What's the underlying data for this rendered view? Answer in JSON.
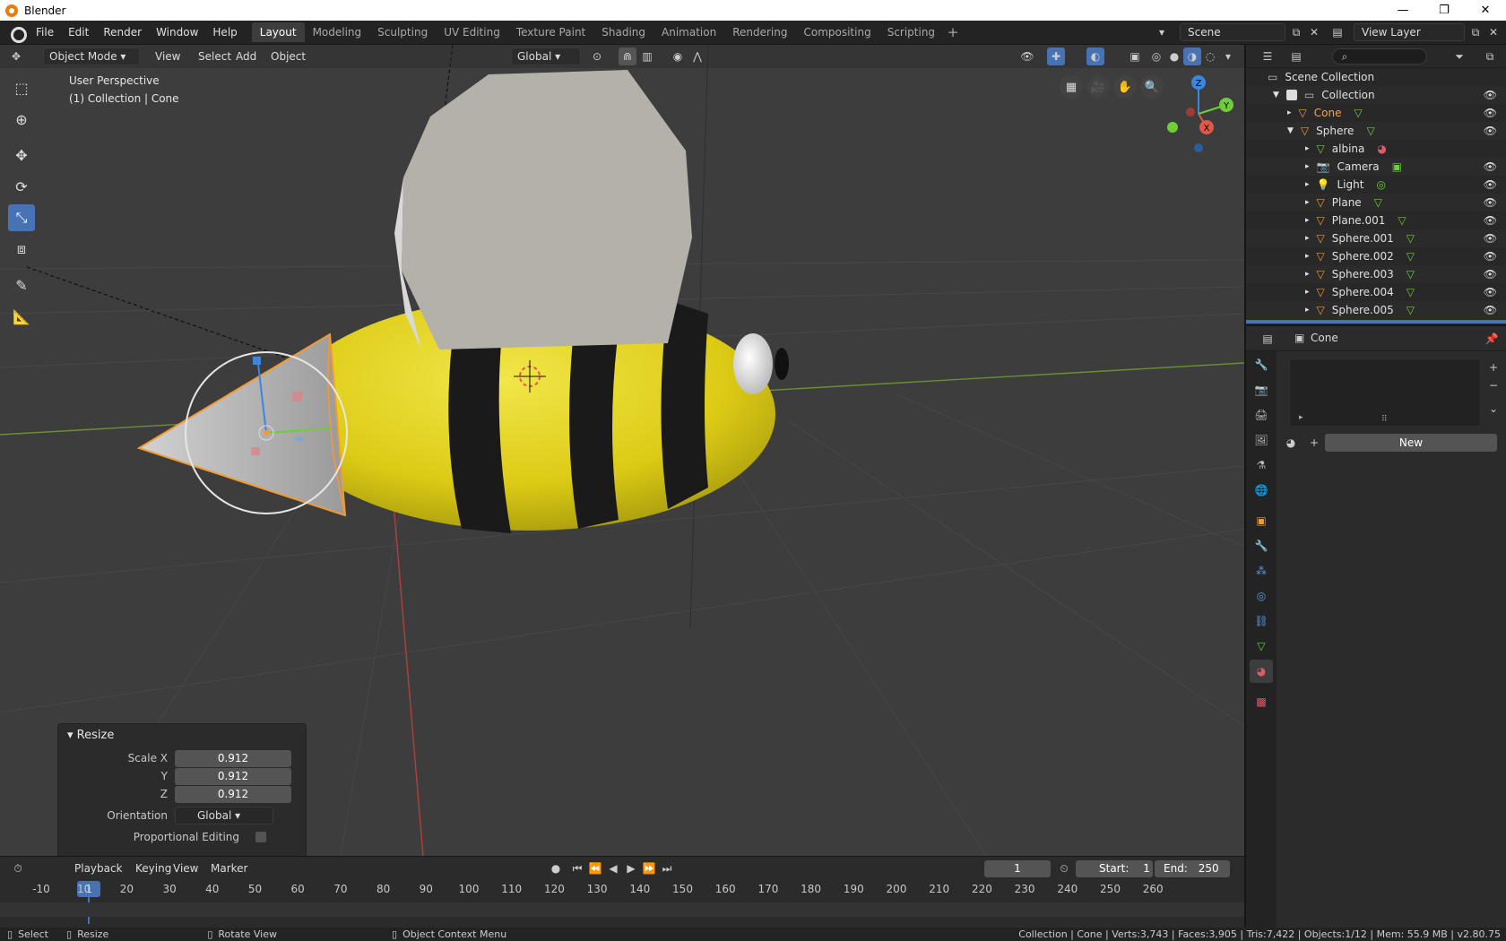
{
  "window": {
    "title": "Blender",
    "minimize": "—",
    "restore": "❐",
    "close": "✕"
  },
  "menu": [
    "File",
    "Edit",
    "Render",
    "Window",
    "Help"
  ],
  "workspaces": [
    "Layout",
    "Modeling",
    "Sculpting",
    "UV Editing",
    "Texture Paint",
    "Shading",
    "Animation",
    "Rendering",
    "Compositing",
    "Scripting"
  ],
  "active_workspace": "Layout",
  "scene": {
    "name": "Scene",
    "view_layer": "View Layer"
  },
  "viewport": {
    "mode": "Object Mode",
    "menus": [
      "View",
      "Select",
      "Add",
      "Object"
    ],
    "transform_orientation": "Global",
    "perspective": "User Perspective",
    "collection_info": "(1) Collection | Cone",
    "gizmo_axes": {
      "x": "X",
      "y": "Y",
      "z": "Z"
    }
  },
  "resize_panel": {
    "title": "Resize",
    "scale_x_label": "Scale X",
    "scale_x": "0.912",
    "y_label": "Y",
    "y": "0.912",
    "z_label": "Z",
    "z": "0.912",
    "orientation_label": "Orientation",
    "orientation": "Global",
    "proportional_label": "Proportional Editing"
  },
  "timeline": {
    "menus": [
      "Playback",
      "Keying",
      "View",
      "Marker"
    ],
    "current_frame": "1",
    "start_label": "Start:",
    "start": "1",
    "end_label": "End:",
    "end": "250",
    "ticks": [
      "-10",
      "10",
      "20",
      "30",
      "40",
      "50",
      "60",
      "70",
      "80",
      "90",
      "100",
      "110",
      "120",
      "130",
      "140",
      "150",
      "160",
      "170",
      "180",
      "190",
      "200",
      "210",
      "220",
      "230",
      "240",
      "250",
      "260"
    ],
    "cursor_label": "1"
  },
  "outliner": {
    "root": "Scene Collection",
    "collection": "Collection",
    "items": [
      "Cone",
      "Sphere",
      "albina",
      "Camera",
      "Light",
      "Plane",
      "Plane.001",
      "Sphere.001",
      "Sphere.002",
      "Sphere.003",
      "Sphere.004",
      "Sphere.005"
    ],
    "active_item": "Cone"
  },
  "properties": {
    "object_name": "Cone",
    "new_button": "New"
  },
  "statusbar": {
    "select": "Select",
    "resize": "Resize",
    "rotate": "Rotate View",
    "context": "Object Context Menu",
    "stats": "Collection | Cone | Verts:3,743 | Faces:3,905 | Tris:7,422 | Objects:1/12 | Mem: 55.9 MB | v2.80.75"
  },
  "colors": {
    "accent": "#4772b3",
    "active_object": "#f5a142",
    "viewport_bg": "#3d3d3d",
    "bee_yellow": "#e3d21c",
    "wing": "#b4b1aa"
  }
}
